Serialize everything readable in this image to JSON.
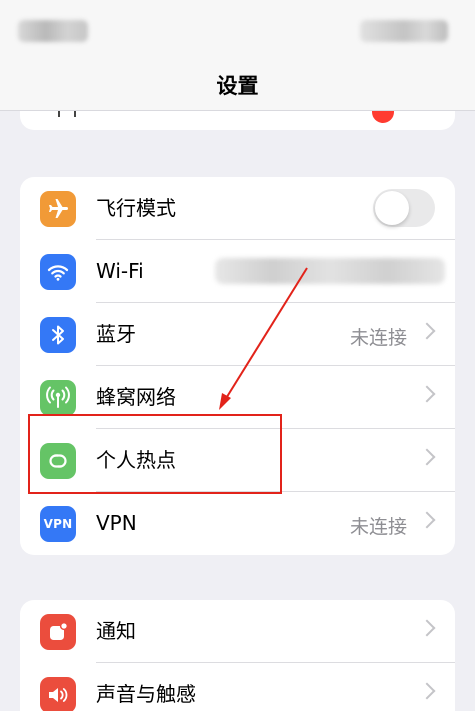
{
  "nav": {
    "title": "设置"
  },
  "connectivity": [
    {
      "id": "airplane",
      "label": "飞行模式",
      "icon": "airplane-icon",
      "icon_bg": "#f19a37",
      "control": "toggle",
      "toggle_on": false
    },
    {
      "id": "wifi",
      "label": "Wi-Fi",
      "icon": "wifi-icon",
      "icon_bg": "#3478f6",
      "control": "blurred-value"
    },
    {
      "id": "bluetooth",
      "label": "蓝牙",
      "icon": "bluetooth-icon",
      "icon_bg": "#3478f6",
      "value": "未连接",
      "control": "chevron"
    },
    {
      "id": "cellular",
      "label": "蜂窝网络",
      "icon": "cellular-icon",
      "icon_bg": "#65c466",
      "control": "chevron"
    },
    {
      "id": "hotspot",
      "label": "个人热点",
      "icon": "hotspot-icon",
      "icon_bg": "#65c466",
      "control": "chevron"
    },
    {
      "id": "vpn",
      "label": "VPN",
      "icon": "vpn-icon",
      "icon_text": "VPN",
      "icon_bg": "#3478f6",
      "value": "未连接",
      "control": "chevron"
    }
  ],
  "notifications": [
    {
      "id": "notifications",
      "label": "通知",
      "icon": "notification-bell-icon",
      "icon_bg": "#eb4d3d",
      "control": "chevron"
    },
    {
      "id": "sounds",
      "label": "声音与触感",
      "icon": "speaker-icon",
      "icon_bg": "#eb4d3d",
      "control": "chevron"
    }
  ],
  "annotation": {
    "color": "#e2231a",
    "highlight_target": "hotspot"
  }
}
